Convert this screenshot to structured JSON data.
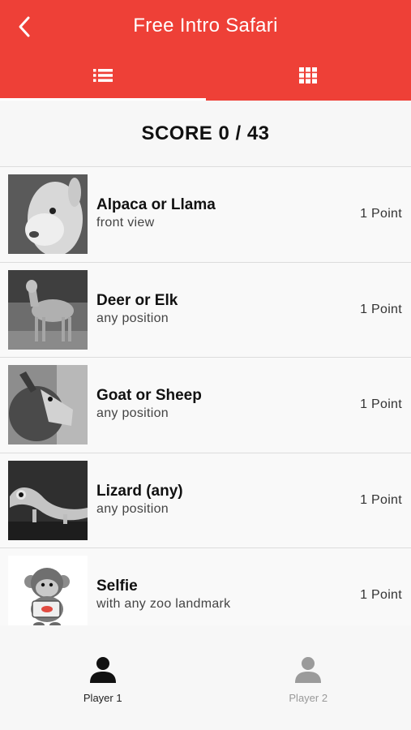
{
  "header": {
    "title": "Free Intro Safari",
    "accent_color": "#ee4037",
    "back_icon": "chevron-left-icon",
    "tabs": [
      {
        "icon": "list-icon",
        "active": true
      },
      {
        "icon": "grid-icon",
        "active": false
      }
    ]
  },
  "score": {
    "label": "SCORE 0 / 43"
  },
  "items": [
    {
      "title": "Alpaca or Llama",
      "subtitle": "front view",
      "points": "1 Point"
    },
    {
      "title": "Deer or Elk",
      "subtitle": "any position",
      "points": "1 Point"
    },
    {
      "title": "Goat or Sheep",
      "subtitle": "any position",
      "points": "1 Point"
    },
    {
      "title": "Lizard (any)",
      "subtitle": "any position",
      "points": "1 Point"
    },
    {
      "title": "Selfie",
      "subtitle": "with any zoo landmark",
      "points": "1 Point"
    }
  ],
  "bottom_nav": {
    "players": [
      {
        "label": "Player 1",
        "icon": "person-icon",
        "active": true
      },
      {
        "label": "Player 2",
        "icon": "person-icon",
        "active": false
      }
    ]
  }
}
